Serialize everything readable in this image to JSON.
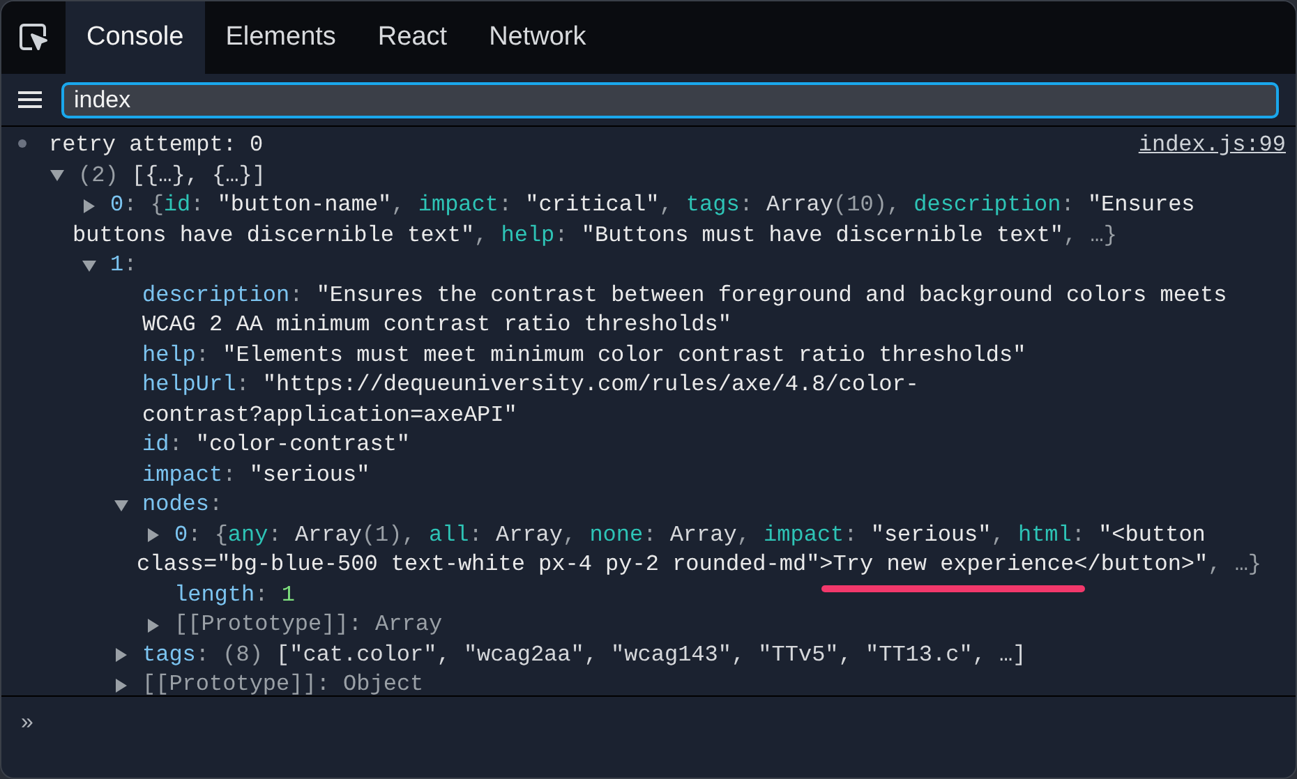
{
  "tabs": [
    {
      "label": "Console",
      "selected": true
    },
    {
      "label": "Elements",
      "selected": false
    },
    {
      "label": "React",
      "selected": false
    },
    {
      "label": "Network",
      "selected": false
    }
  ],
  "filter": {
    "value": "index"
  },
  "console": {
    "message": "retry attempt: 0",
    "source": "index.js:99",
    "tree": {
      "expanded": true,
      "lines": [
        [
          {
            "kind": "dim",
            "text": "(2) "
          },
          {
            "kind": "plain",
            "text": "[{…}, {…}]"
          }
        ]
      ],
      "children": [
        {
          "expanded": false,
          "lines": [
            [
              {
                "kind": "index",
                "text": "0"
              },
              {
                "kind": "punct",
                "text": ": {"
              },
              {
                "kind": "pkey",
                "text": "id"
              },
              {
                "kind": "punct",
                "text": ": "
              },
              {
                "kind": "str",
                "text": "\"button-name\""
              },
              {
                "kind": "punct",
                "text": ", "
              },
              {
                "kind": "pkey",
                "text": "impact"
              },
              {
                "kind": "punct",
                "text": ": "
              },
              {
                "kind": "str",
                "text": "\"critical\""
              },
              {
                "kind": "punct",
                "text": ", "
              },
              {
                "kind": "pkey",
                "text": "tags"
              },
              {
                "kind": "punct",
                "text": ": "
              },
              {
                "kind": "plain",
                "text": "Array"
              },
              {
                "kind": "dim",
                "text": "(10)"
              },
              {
                "kind": "punct",
                "text": ", "
              },
              {
                "kind": "pkey",
                "text": "description"
              },
              {
                "kind": "punct",
                "text": ": "
              },
              {
                "kind": "str",
                "text": "\"Ensures"
              }
            ],
            [
              {
                "kind": "str",
                "text": "buttons have discernible text\""
              },
              {
                "kind": "punct",
                "text": ", "
              },
              {
                "kind": "pkey",
                "text": "help"
              },
              {
                "kind": "punct",
                "text": ": "
              },
              {
                "kind": "str",
                "text": "\"Buttons must have discernible text\""
              },
              {
                "kind": "punct",
                "text": ", …}"
              }
            ]
          ]
        },
        {
          "expanded": true,
          "lines": [
            [
              {
                "kind": "index",
                "text": "1"
              },
              {
                "kind": "punct",
                "text": ":"
              }
            ]
          ],
          "children": [
            {
              "lines": [
                [
                  {
                    "kind": "key",
                    "text": "description"
                  },
                  {
                    "kind": "punct",
                    "text": ": "
                  },
                  {
                    "kind": "str",
                    "text": "\"Ensures the contrast between foreground and background colors meets"
                  }
                ],
                [
                  {
                    "kind": "str",
                    "text": "WCAG 2 AA minimum contrast ratio thresholds\""
                  }
                ]
              ]
            },
            {
              "lines": [
                [
                  {
                    "kind": "key",
                    "text": "help"
                  },
                  {
                    "kind": "punct",
                    "text": ": "
                  },
                  {
                    "kind": "str",
                    "text": "\"Elements must meet minimum color contrast ratio thresholds\""
                  }
                ]
              ]
            },
            {
              "lines": [
                [
                  {
                    "kind": "key",
                    "text": "helpUrl"
                  },
                  {
                    "kind": "punct",
                    "text": ": "
                  },
                  {
                    "kind": "str",
                    "text": "\"https://dequeuniversity.com/rules/axe/4.8/color-"
                  }
                ],
                [
                  {
                    "kind": "str",
                    "text": "contrast?application=axeAPI\""
                  }
                ]
              ]
            },
            {
              "lines": [
                [
                  {
                    "kind": "key",
                    "text": "id"
                  },
                  {
                    "kind": "punct",
                    "text": ": "
                  },
                  {
                    "kind": "str",
                    "text": "\"color-contrast\""
                  }
                ]
              ]
            },
            {
              "lines": [
                [
                  {
                    "kind": "key",
                    "text": "impact"
                  },
                  {
                    "kind": "punct",
                    "text": ": "
                  },
                  {
                    "kind": "str",
                    "text": "\"serious\""
                  }
                ]
              ]
            },
            {
              "expanded": true,
              "lines": [
                [
                  {
                    "kind": "key",
                    "text": "nodes"
                  },
                  {
                    "kind": "punct",
                    "text": ":"
                  }
                ]
              ],
              "children": [
                {
                  "expanded": false,
                  "lines": [
                    [
                      {
                        "kind": "index",
                        "text": "0"
                      },
                      {
                        "kind": "punct",
                        "text": ": {"
                      },
                      {
                        "kind": "pkey",
                        "text": "any"
                      },
                      {
                        "kind": "punct",
                        "text": ": "
                      },
                      {
                        "kind": "plain",
                        "text": "Array"
                      },
                      {
                        "kind": "dim",
                        "text": "(1)"
                      },
                      {
                        "kind": "punct",
                        "text": ", "
                      },
                      {
                        "kind": "pkey",
                        "text": "all"
                      },
                      {
                        "kind": "punct",
                        "text": ": "
                      },
                      {
                        "kind": "plain",
                        "text": "Array"
                      },
                      {
                        "kind": "punct",
                        "text": ", "
                      },
                      {
                        "kind": "pkey",
                        "text": "none"
                      },
                      {
                        "kind": "punct",
                        "text": ": "
                      },
                      {
                        "kind": "plain",
                        "text": "Array"
                      },
                      {
                        "kind": "punct",
                        "text": ", "
                      },
                      {
                        "kind": "pkey",
                        "text": "impact"
                      },
                      {
                        "kind": "punct",
                        "text": ": "
                      },
                      {
                        "kind": "str",
                        "text": "\"serious\""
                      },
                      {
                        "kind": "punct",
                        "text": ", "
                      },
                      {
                        "kind": "pkey",
                        "text": "html"
                      },
                      {
                        "kind": "punct",
                        "text": ": "
                      },
                      {
                        "kind": "str",
                        "text": "\"<button"
                      }
                    ],
                    [
                      {
                        "kind": "str",
                        "text": "class=\"bg-blue-500 text-white px-4 py-2 rounded-md\">"
                      },
                      {
                        "kind": "str",
                        "text": "Try new experience",
                        "underlined": true
                      },
                      {
                        "kind": "str",
                        "text": "</button>\""
                      },
                      {
                        "kind": "punct",
                        "text": ", …}"
                      }
                    ]
                  ]
                },
                {
                  "lines": [
                    [
                      {
                        "kind": "key",
                        "text": "length"
                      },
                      {
                        "kind": "punct",
                        "text": ": "
                      },
                      {
                        "kind": "num",
                        "text": "1"
                      }
                    ]
                  ]
                },
                {
                  "expanded": false,
                  "lines": [
                    [
                      {
                        "kind": "dim",
                        "text": "[[Prototype]]"
                      },
                      {
                        "kind": "punct",
                        "text": ": "
                      },
                      {
                        "kind": "dim",
                        "text": "Array"
                      }
                    ]
                  ]
                }
              ]
            },
            {
              "expanded": false,
              "lines": [
                [
                  {
                    "kind": "key",
                    "text": "tags"
                  },
                  {
                    "kind": "punct",
                    "text": ": "
                  },
                  {
                    "kind": "dim",
                    "text": "(8) "
                  },
                  {
                    "kind": "plain",
                    "text": "[\"cat.color\", \"wcag2aa\", \"wcag143\", \"TTv5\", \"TT13.c\", …]"
                  }
                ]
              ]
            },
            {
              "expanded": false,
              "lines": [
                [
                  {
                    "kind": "dim",
                    "text": "[[Prototype]]"
                  },
                  {
                    "kind": "punct",
                    "text": ": "
                  },
                  {
                    "kind": "dim",
                    "text": "Object"
                  }
                ]
              ]
            }
          ]
        }
      ]
    },
    "prompt": "»"
  }
}
